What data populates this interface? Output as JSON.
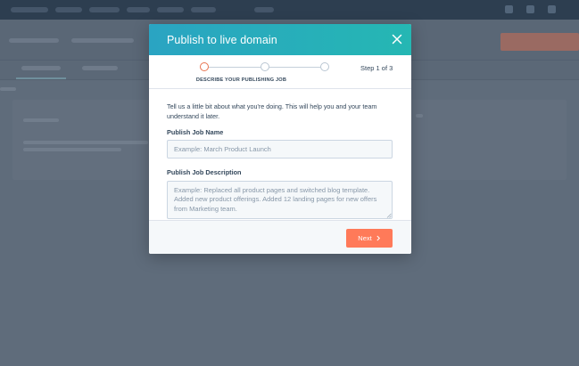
{
  "modal": {
    "title": "Publish to live domain",
    "stepper": {
      "steps": 3,
      "current": 1,
      "caption": "DESCRIBE YOUR PUBLISHING JOB",
      "step_count": "Step 1 of 3"
    },
    "intro": "Tell us a little bit about what you're doing. This will help you and your team understand it later.",
    "job_name": {
      "label": "Publish Job Name",
      "placeholder": "Example: March Product Launch",
      "value": ""
    },
    "job_description": {
      "label": "Publish Job Description",
      "placeholder": "Example: Replaced all product pages and switched blog template. Added new product offerings. Added 12 landing pages for new offers from Marketing team.",
      "value": ""
    },
    "next_label": "Next"
  },
  "icons": {
    "close": "close-icon",
    "next": "chevron-right-icon"
  },
  "colors": {
    "header_gradient_start": "#2aa4c2",
    "header_gradient_end": "#25b7b3",
    "primary_button": "#ff7a59",
    "active_step": "#e8734f",
    "text": "#33475b"
  }
}
